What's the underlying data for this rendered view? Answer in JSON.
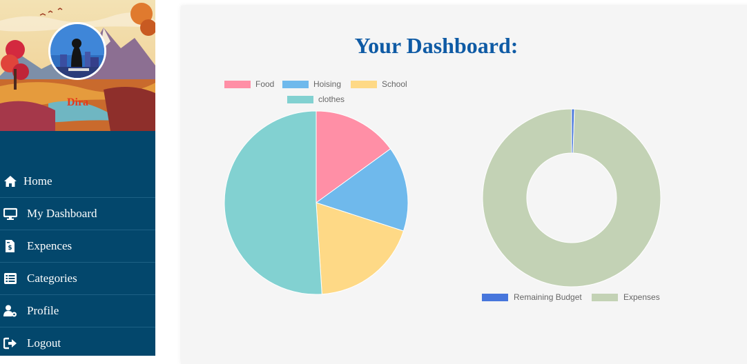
{
  "user": {
    "name": "Dira"
  },
  "nav": {
    "items": [
      {
        "label": "Home",
        "icon": "home-icon"
      },
      {
        "label": "My Dashboard",
        "icon": "monitor-icon"
      },
      {
        "label": "Expences",
        "icon": "invoice-icon"
      },
      {
        "label": "Categories",
        "icon": "list-icon"
      },
      {
        "label": "Profile",
        "icon": "user-cog-icon"
      },
      {
        "label": "Logout",
        "icon": "logout-icon"
      }
    ]
  },
  "main": {
    "title": "Your Dashboard:"
  },
  "colors": {
    "sidebar": "#03476c",
    "title": "#0f5ba5",
    "food": "#ff8fa6",
    "hoising": "#6fb9ec",
    "school": "#fed986",
    "clothes": "#82d1d1",
    "remaining": "#4776dc",
    "expenses": "#c3d2b5"
  },
  "chart_data": [
    {
      "type": "pie",
      "labels": [
        "Food",
        "Hoising",
        "School",
        "clothes"
      ],
      "values": [
        15,
        15,
        19,
        51
      ],
      "colors": [
        "#ff8fa6",
        "#6fb9ec",
        "#fed986",
        "#82d1d1"
      ],
      "legend": "top"
    },
    {
      "type": "doughnut",
      "labels": [
        "Remaining Budget",
        "Expenses"
      ],
      "values": [
        0.5,
        99.5
      ],
      "colors": [
        "#4776dc",
        "#c3d2b5"
      ],
      "legend": "bottom"
    }
  ]
}
